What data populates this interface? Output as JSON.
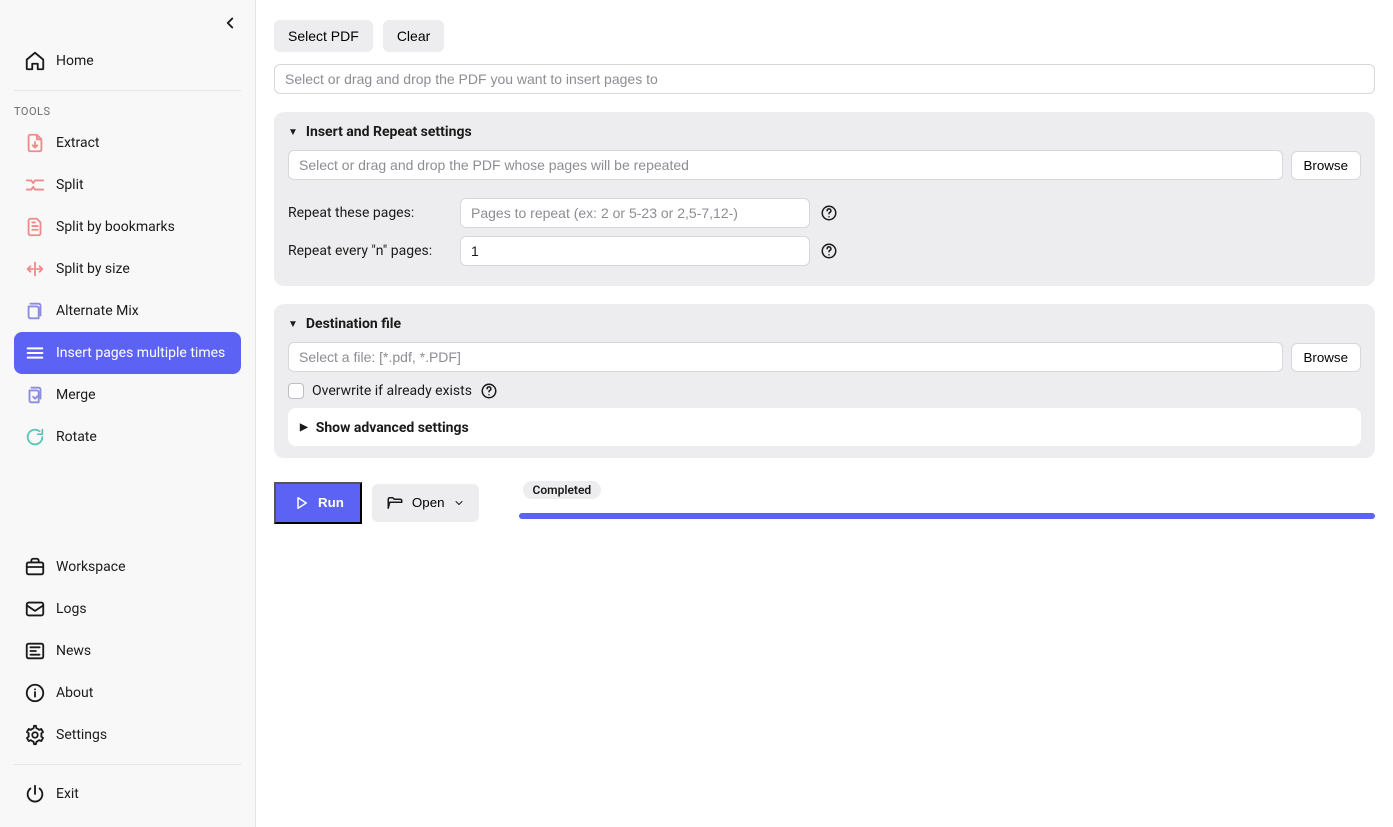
{
  "sidebar": {
    "home": "Home",
    "tools_label": "TOOLS",
    "tools": [
      {
        "label": "Extract"
      },
      {
        "label": "Split"
      },
      {
        "label": "Split by bookmarks"
      },
      {
        "label": "Split by size"
      },
      {
        "label": "Alternate Mix"
      },
      {
        "label": "Insert pages multiple times"
      },
      {
        "label": "Merge"
      },
      {
        "label": "Rotate"
      }
    ],
    "bottom": [
      {
        "label": "Workspace"
      },
      {
        "label": "Logs"
      },
      {
        "label": "News"
      },
      {
        "label": "About"
      },
      {
        "label": "Settings"
      }
    ],
    "exit": "Exit"
  },
  "top": {
    "select_pdf": "Select PDF",
    "clear": "Clear"
  },
  "target_placeholder": "Select or drag and drop the PDF you want to insert pages to",
  "panel1": {
    "title": "Insert and Repeat settings",
    "source_placeholder": "Select or drag and drop the PDF whose pages will be repeated",
    "browse": "Browse",
    "repeat_pages_label": "Repeat these pages:",
    "repeat_pages_placeholder": "Pages to repeat (ex: 2 or 5-23 or 2,5-7,12-)",
    "repeat_every_label": "Repeat every \"n\" pages:",
    "repeat_every_value": "1"
  },
  "panel2": {
    "title": "Destination file",
    "dest_placeholder": "Select a file: [*.pdf, *.PDF]",
    "browse": "Browse",
    "overwrite": "Overwrite if already exists",
    "advanced": "Show advanced settings"
  },
  "actions": {
    "run": "Run",
    "open": "Open",
    "status": "Completed"
  }
}
